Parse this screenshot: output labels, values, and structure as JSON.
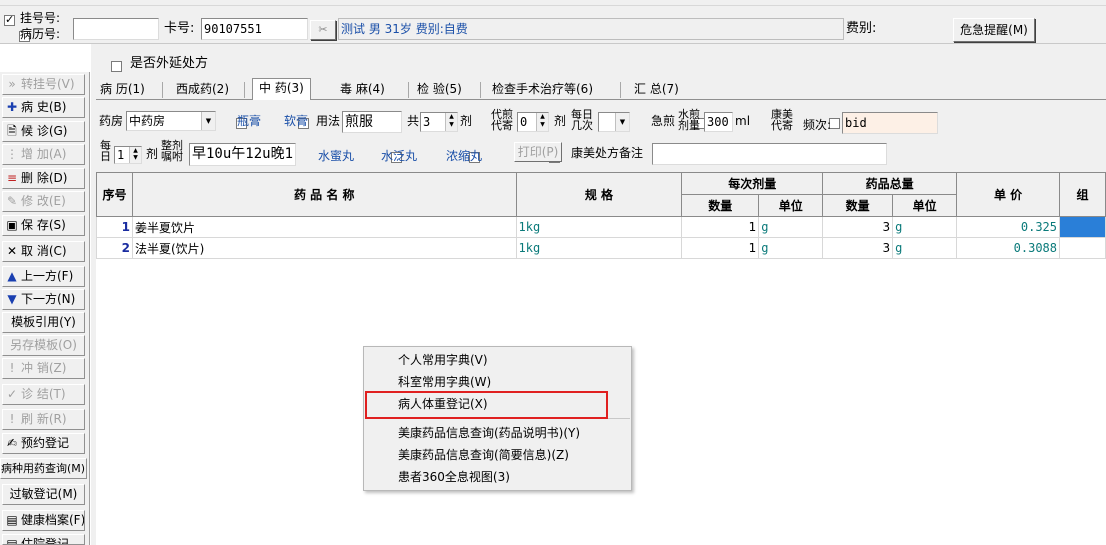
{
  "header": {
    "regno_label": "挂号号:",
    "medrec_label": "病历号:",
    "regno_checked": true,
    "medrec_checked": false,
    "regno_value": "",
    "card_label": "卡号:",
    "card_value": "90107551",
    "patient_info": "测试 男 31岁 费别:自费",
    "fee_label": "费别:",
    "fee_value": "",
    "alert_button": "危急提醒(M)"
  },
  "sidebar": {
    "items": [
      {
        "label": "转挂号(V)",
        "icon": "double-chevron-icon",
        "enabled": false
      },
      {
        "label": "病  史(B)",
        "icon": "plus-icon",
        "enabled": true
      },
      {
        "label": "候  诊(G)",
        "icon": "document-icon",
        "enabled": true
      },
      {
        "label": "增  加(A)",
        "icon": "add-icon",
        "enabled": false
      },
      {
        "label": "删  除(D)",
        "icon": "delete-icon",
        "enabled": true
      },
      {
        "label": "修  改(E)",
        "icon": "edit-icon",
        "enabled": false
      },
      {
        "label": "保  存(S)",
        "icon": "save-icon",
        "enabled": true
      },
      {
        "label": "取  消(C)",
        "icon": "cancel-icon",
        "enabled": true
      },
      {
        "label": "上一方(F)",
        "icon": "up-arrow-icon",
        "enabled": true
      },
      {
        "label": "下一方(N)",
        "icon": "down-arrow-icon",
        "enabled": true
      },
      {
        "label": "模板引用(Y)",
        "icon": "",
        "enabled": true
      },
      {
        "label": "另存模板(O)",
        "icon": "",
        "enabled": false
      },
      {
        "label": "冲  销(Z)",
        "icon": "exclamation-icon",
        "enabled": false
      },
      {
        "label": "诊  结(T)",
        "icon": "check-icon",
        "enabled": false
      },
      {
        "label": "刷  新(R)",
        "icon": "exclamation-icon",
        "enabled": false
      },
      {
        "label": "预约登记",
        "icon": "calendar-icon",
        "enabled": true
      },
      {
        "label": "病种用药查询(M)",
        "icon": "",
        "enabled": true
      },
      {
        "label": "过敏登记(M)",
        "icon": "",
        "enabled": true
      },
      {
        "label": "健康档案(F)",
        "icon": "folder-icon",
        "enabled": true
      },
      {
        "label": "住院登记",
        "icon": "bed-icon",
        "enabled": true
      }
    ]
  },
  "main": {
    "outside_rx_label": "是否外延处方",
    "outside_rx_checked": false,
    "tabs": [
      {
        "label": "病 历(1)"
      },
      {
        "label": "西成药(2)"
      },
      {
        "label": "中 药(3)"
      },
      {
        "label": "毒 麻(4)"
      },
      {
        "label": "检 验(5)"
      },
      {
        "label": "检查手术治疗等(6)"
      },
      {
        "label": "汇 总(7)"
      }
    ],
    "selected_tab": 2,
    "form": {
      "pharmacy_label": "药房",
      "pharmacy_value": "中药房",
      "bottle_label": "瓶膏",
      "soft_label": "软膏",
      "usage_label": "用法",
      "usage_value": "煎服",
      "total_label": "共",
      "doses_value": "3",
      "dose_unit": "剂",
      "proxy_label_1": "代煎",
      "proxy_label_2": "代寄",
      "proxy_value": "0",
      "proxy_unit": "剂",
      "perday_label_1": "每日",
      "perday_label_2": "几次",
      "perday_value": "",
      "urgent_label": "急煎",
      "water_label_1": "水煎",
      "water_label_2": "剂量",
      "water_value": "300",
      "water_unit": "ml",
      "kangmei_label_1": "康美",
      "kangmei_label_2": "代寄",
      "freq_label": "频次:",
      "freq_value": "bid",
      "daily_label_1": "每",
      "daily_label_2": "日",
      "daily_value": "1",
      "daily_unit": "剂",
      "instr_label_1": "整剂",
      "instr_label_2": "嘱咐",
      "instr_value": "早10u午12u晚1",
      "pill1_label": "水蜜丸",
      "pill2_label": "水泛丸",
      "pill3_label": "浓缩丸",
      "print_button": "打印(P)",
      "note_label": "康美处方备注",
      "note_value": ""
    },
    "table": {
      "headers": {
        "seq": "序号",
        "name": "药  品  名  称",
        "spec": "规    格",
        "per_dose": "每次剂量",
        "total_qty": "药品总量",
        "qty": "数量",
        "unit": "单位",
        "price": "单 价",
        "extra": "组"
      },
      "rows": [
        {
          "seq": "1",
          "name": "姜半夏饮片",
          "spec": "1kg",
          "dose_qty": "1",
          "dose_unit": "g",
          "total_qty": "3",
          "total_unit": "g",
          "price": "0.325"
        },
        {
          "seq": "2",
          "name": "法半夏(饮片)",
          "spec": "1kg",
          "dose_qty": "1",
          "dose_unit": "g",
          "total_qty": "3",
          "total_unit": "g",
          "price": "0.3088"
        }
      ]
    }
  },
  "context_menu": {
    "items": [
      {
        "label": "个人常用字典(V)"
      },
      {
        "label": "科室常用字典(W)"
      },
      {
        "label": "病人体重登记(X)"
      },
      {
        "label": "美康药品信息查询(药品说明书)(Y)"
      },
      {
        "label": "美康药品信息查询(简要信息)(Z)"
      },
      {
        "label": "患者360全息视图(3)"
      }
    ],
    "highlighted_index": 2
  },
  "colors": {
    "accent_blue": "#1a4fa8",
    "teal": "#0a7a7a",
    "highlight_red": "#e02020",
    "selection_blue": "#2a7fd8"
  }
}
